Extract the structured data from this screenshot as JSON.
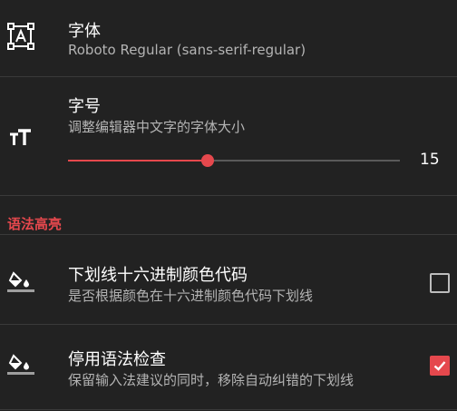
{
  "font": {
    "icon": "font-box-icon",
    "title": "字体",
    "subtitle": "Roboto Regular (sans-serif-regular)"
  },
  "font_size": {
    "icon": "text-size-icon",
    "title": "字号",
    "subtitle": "调整编辑器中文字的字体大小",
    "value": "15",
    "slider_fraction": 0.42
  },
  "syntax_section": {
    "header": "语法高亮"
  },
  "underline_hex": {
    "icon": "format-color-fill-icon",
    "title": "下划线十六进制颜色代码",
    "subtitle": "是否根据颜色在十六进制颜色代码下划线",
    "checked": false
  },
  "disable_spellcheck": {
    "icon": "format-color-fill-icon",
    "title": "停用语法检查",
    "subtitle": "保留输入法建议的同时，移除自动纠错的下划线",
    "checked": true
  },
  "colors": {
    "accent": "#e5484d",
    "background": "#222222",
    "divider": "#3a3a3a"
  }
}
